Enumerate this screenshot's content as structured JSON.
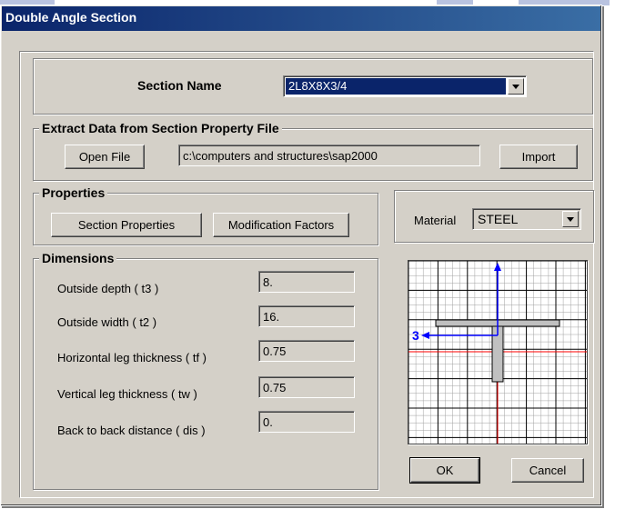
{
  "window": {
    "title": "Double Angle Section"
  },
  "section_name": {
    "label": "Section Name",
    "value": "2L8X8X3/4"
  },
  "extract": {
    "legend": "Extract Data from Section Property File",
    "open_file_label": "Open File",
    "path": "c:\\computers and structures\\sap2000",
    "import_label": "Import"
  },
  "properties": {
    "legend": "Properties",
    "section_properties_label": "Section Properties",
    "modification_factors_label": "Modification Factors"
  },
  "material": {
    "label": "Material",
    "value": "STEEL"
  },
  "dimensions": {
    "legend": "Dimensions",
    "rows": [
      {
        "label": "Outside depth  ( t3 )",
        "value": "8."
      },
      {
        "label": "Outside width  ( t2 )",
        "value": "16."
      },
      {
        "label": "Horizontal leg thickness  ( tf )",
        "value": "0.75"
      },
      {
        "label": "Vertical leg thickness  ( tw )",
        "value": "0.75"
      },
      {
        "label": "Back to back distance  ( dis )",
        "value": "0."
      }
    ]
  },
  "preview": {
    "axis_label": "3",
    "colors": {
      "grid": "#000000",
      "axis_red": "#ff0000",
      "axis_blue": "#0000ff",
      "section_fill": "#c0c0c0"
    }
  },
  "buttons": {
    "ok_label": "OK",
    "cancel_label": "Cancel"
  }
}
